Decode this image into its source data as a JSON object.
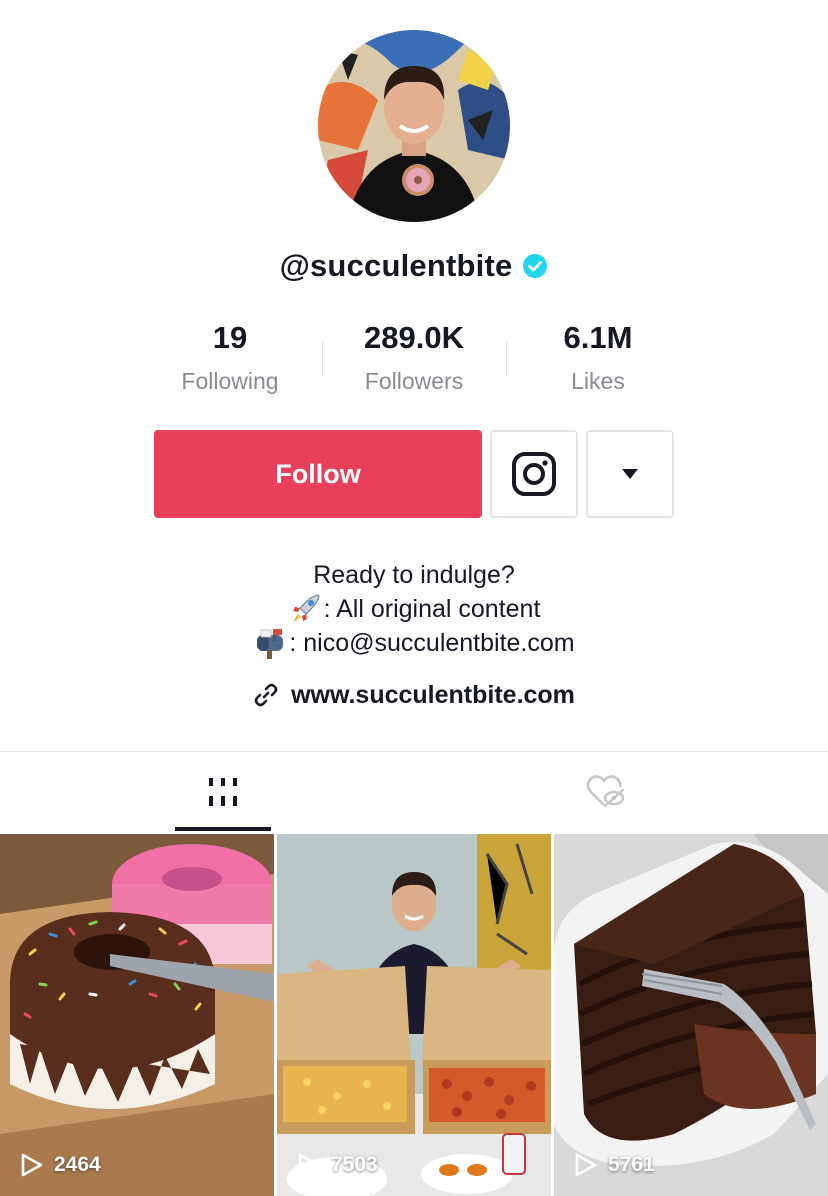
{
  "profile": {
    "username": "@succulentbite",
    "verified": true
  },
  "stats": [
    {
      "value": "19",
      "label": "Following"
    },
    {
      "value": "289.0K",
      "label": "Followers"
    },
    {
      "value": "6.1M",
      "label": "Likes"
    }
  ],
  "actions": {
    "follow_label": "Follow",
    "instagram_icon": "instagram-icon",
    "more_icon": "caret-down-icon"
  },
  "bio": {
    "line1": "Ready to indulge?",
    "line2": ": All original content",
    "line2_icon": "rocket-icon",
    "line3": ": nico@succulentbite.com",
    "line3_icon": "mailbox-icon",
    "link": "www.succulentbite.com",
    "link_icon": "link-icon"
  },
  "tabs": [
    {
      "name": "videos",
      "icon": "grid-icon",
      "active": true
    },
    {
      "name": "liked",
      "icon": "liked-hidden-icon",
      "active": false
    }
  ],
  "videos": [
    {
      "views": "2464"
    },
    {
      "views": "7503"
    },
    {
      "views": "5761"
    }
  ],
  "colors": {
    "accent": "#ea3f59",
    "verified": "#20d5ec",
    "muted_text": "#8a8b91"
  }
}
